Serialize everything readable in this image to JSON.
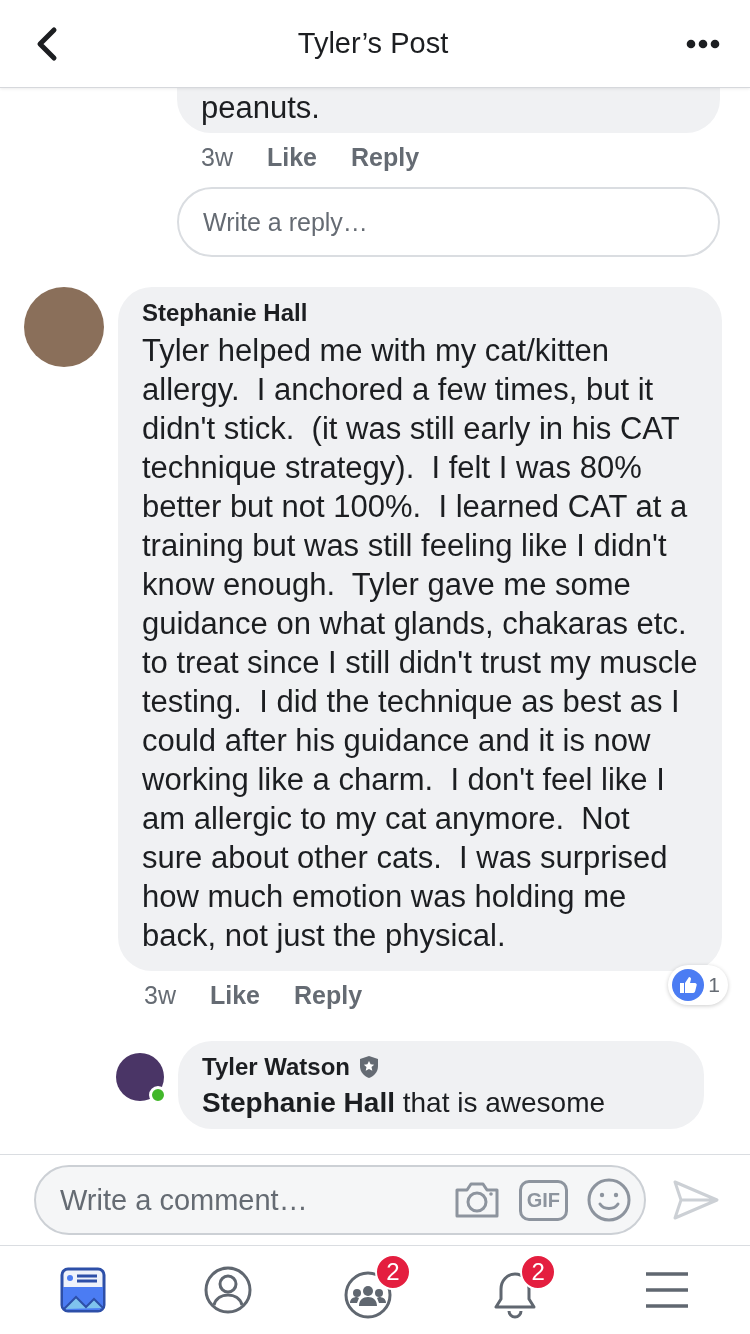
{
  "header": {
    "title": "Tyler’s Post"
  },
  "comments": [
    {
      "kind": "tail",
      "text": "peanuts.",
      "time": "3w",
      "actions": [
        "Like",
        "Reply"
      ],
      "reply_field": {
        "placeholder": "Write a reply…"
      }
    },
    {
      "kind": "full",
      "author": "Stephanie Hall",
      "text": "Tyler helped me with my cat/kitten allergy.  I anchored a few times, but it didn't stick.  (it was still early in his CAT technique strategy).  I felt I was 80% better but not 100%.  I learned CAT at a training but was still feeling like I didn't know enough.  Tyler gave me some guidance on what glands, chakaras etc. to treat since I still didn't trust my muscle testing.  I did the technique as best as I could after his guidance and it is now working like a charm.  I don't feel like I am allergic to my cat anymore.  Not sure about other cats.  I was surprised how much emotion was holding me back, not just the physical.",
      "time": "3w",
      "actions": [
        "Like",
        "Reply"
      ],
      "reaction_count": "1"
    },
    {
      "kind": "reply",
      "author": "Tyler Watson",
      "admin": true,
      "online": true,
      "text": "**Stephanie Hall** that is awesome"
    }
  ],
  "composer": {
    "placeholder": "Write a comment…",
    "gif_label": "GIF"
  },
  "nav": [
    {
      "kind": "feed",
      "selected": true
    },
    {
      "kind": "profile",
      "selected": false
    },
    {
      "kind": "groups",
      "badge": "2",
      "selected": false
    },
    {
      "kind": "bell",
      "badge": "2",
      "selected": false
    },
    {
      "kind": "menu",
      "selected": false
    }
  ]
}
